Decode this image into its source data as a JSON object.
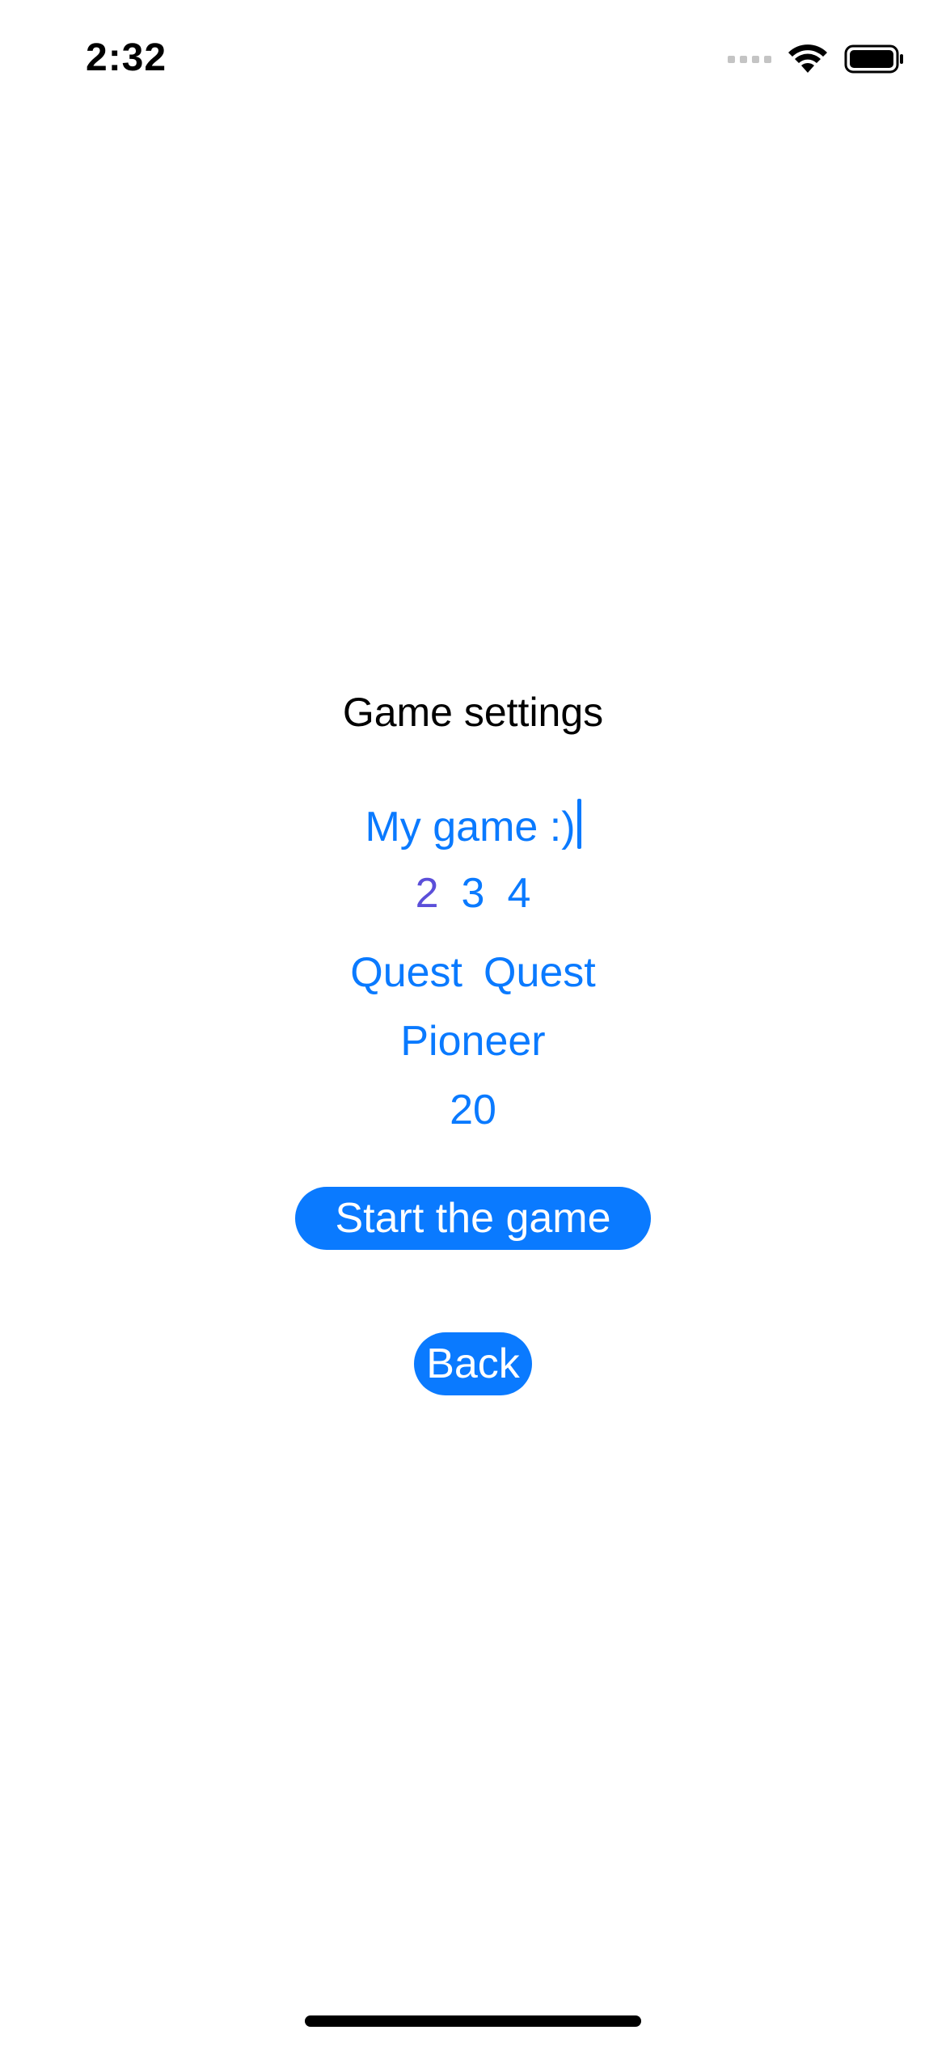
{
  "status_bar": {
    "time": "2:32",
    "icons": [
      "signal-icon",
      "wifi-icon",
      "battery-icon"
    ]
  },
  "settings": {
    "title": "Game settings",
    "game_name": "My game :)",
    "player_options": [
      "2",
      "3",
      "4"
    ],
    "selected_player_option": "2",
    "roles": [
      "Quest",
      "Quest"
    ],
    "game_type": "Pioneer",
    "count": "20"
  },
  "buttons": {
    "start_label": "Start the game",
    "back_label": "Back"
  },
  "colors": {
    "accent": "#0a7aff",
    "selected": "#5b4fd9",
    "text": "#000000",
    "background": "#ffffff"
  }
}
